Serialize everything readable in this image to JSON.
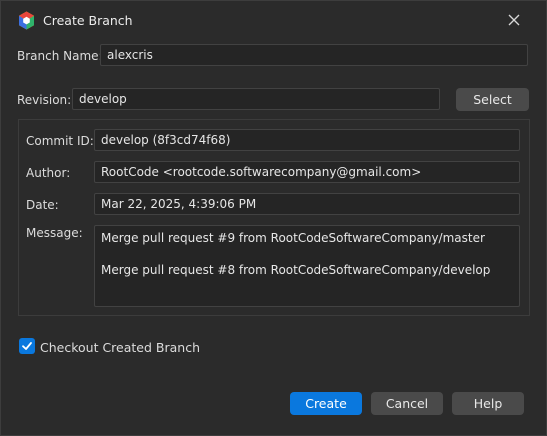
{
  "window": {
    "title": "Create Branch"
  },
  "form": {
    "branch_name_label": "Branch Name:",
    "branch_name_value": "alexcris",
    "revision_label": "Revision:",
    "revision_value": "develop",
    "select_label": "Select"
  },
  "commit": {
    "commit_id_label": "Commit ID:",
    "commit_id_value": "develop (8f3cd74f68)",
    "author_label": "Author:",
    "author_value": "RootCode <rootcode.softwarecompany@gmail.com>",
    "date_label": "Date:",
    "date_value": "Mar 22, 2025, 4:39:06 PM",
    "message_label": "Message:",
    "message_lines": [
      "Merge pull request #9 from RootCodeSoftwareCompany/master",
      "",
      "Merge pull request #8 from RootCodeSoftwareCompany/develop"
    ]
  },
  "checkout": {
    "label": "Checkout Created Branch",
    "checked": true
  },
  "buttons": {
    "create": "Create",
    "cancel": "Cancel",
    "help": "Help"
  },
  "colors": {
    "accent": "#0a78de",
    "background": "#2b2b2b",
    "field_bg": "#252525"
  },
  "icons": {
    "app": "app-logo-icon",
    "close": "close-icon",
    "check": "checkmark-icon"
  }
}
